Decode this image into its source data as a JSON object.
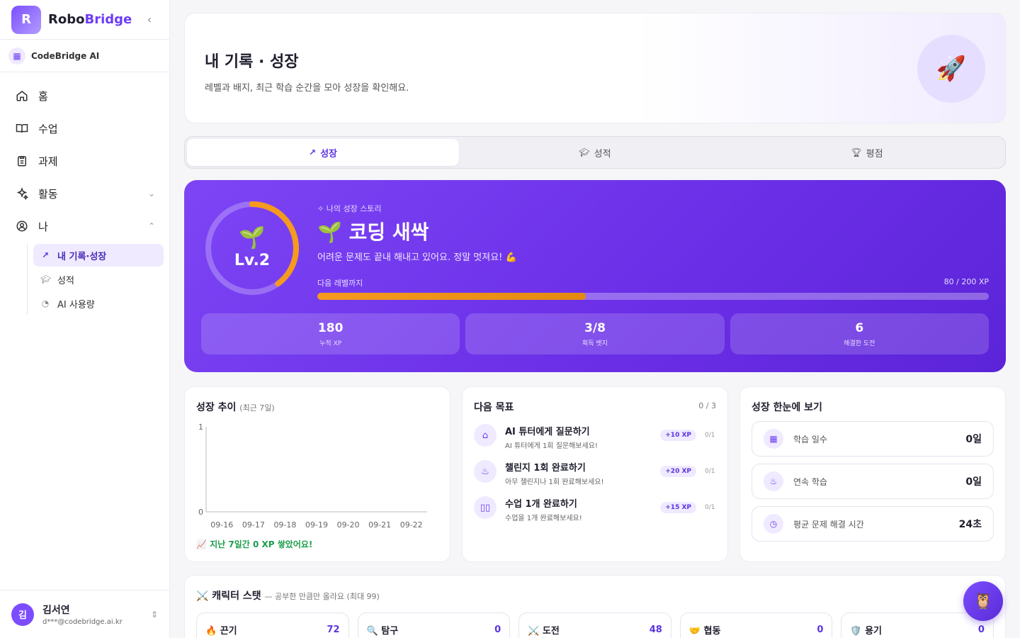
{
  "brand": {
    "logo_text": "R",
    "name_a": "Robo",
    "name_b": "Bridge"
  },
  "org": {
    "name": "CodeBridge AI"
  },
  "nav": {
    "items": [
      {
        "label": "홈"
      },
      {
        "label": "수업"
      },
      {
        "label": "과제"
      },
      {
        "label": "활동"
      },
      {
        "label": "나"
      }
    ],
    "sub": [
      {
        "label": "내 기록·성장"
      },
      {
        "label": "성적"
      },
      {
        "label": "AI 사용량"
      }
    ]
  },
  "user": {
    "initial": "김",
    "name": "김서연",
    "email": "d***@codebridge.ai.kr"
  },
  "header": {
    "title": "내 기록 · 성장",
    "subtitle": "레벨과 배지, 최근 학습 순간을 모아 성장을 확인해요."
  },
  "tabs": [
    {
      "label": "성장"
    },
    {
      "label": "성적"
    },
    {
      "label": "평점"
    }
  ],
  "hero": {
    "level": "Lv.2",
    "story_label": "나의 성장 스토리",
    "title": "🌱 코딩 새싹",
    "desc": "어려운 문제도 끝내 해내고 있어요. 정말 멋져요! 💪",
    "progress_label": "다음 레벨까지",
    "progress_text": "80 / 200 XP",
    "progress": 0.4,
    "stats": [
      {
        "value": "180",
        "label": "누적 XP"
      },
      {
        "value": "3/8",
        "label": "획득 뱃지"
      },
      {
        "value": "6",
        "label": "해결한 도전"
      }
    ]
  },
  "trend": {
    "title": "성장 추이",
    "title_small": "(최근 7일)",
    "footer": "📈 지난 7일간 0 XP 쌓았어요!"
  },
  "chart_data": {
    "type": "line",
    "categories": [
      "09-16",
      "09-17",
      "09-18",
      "09-19",
      "09-20",
      "09-21",
      "09-22"
    ],
    "values": [
      0,
      0,
      0,
      0,
      0,
      0,
      0
    ],
    "ylim": [
      0,
      1
    ],
    "yticks": [
      "1",
      "0"
    ],
    "title": "성장 추이",
    "grid": false
  },
  "goals": {
    "title": "다음 목표",
    "count": "0 / 3",
    "items": [
      {
        "name": "AI 튜터에게 질문하기",
        "desc": "AI 튜터에게 1회 질문해보세요!",
        "xp": "+10 XP",
        "prog": "0/1",
        "icon": "robot-icon"
      },
      {
        "name": "챌린지 1회 완료하기",
        "desc": "아무 챌린지나 1회 완료해보세요!",
        "xp": "+20 XP",
        "prog": "0/1",
        "icon": "flame-icon"
      },
      {
        "name": "수업 1개 완료하기",
        "desc": "수업을 1개 완료해보세요!",
        "xp": "+15 XP",
        "prog": "0/1",
        "icon": "book-icon"
      }
    ]
  },
  "glance": {
    "title": "성장 한눈에 보기",
    "items": [
      {
        "label": "학습 일수",
        "value": "0일"
      },
      {
        "label": "연속 학습",
        "value": "0일"
      },
      {
        "label": "평균 문제 해결 시간",
        "value": "24초"
      }
    ]
  },
  "char_stats": {
    "title": "⚔️ 캐릭터 스탯",
    "title_small": "— 공부한 만큼만 올라요 (최대 99)",
    "items": [
      {
        "label": "🔥 끈기",
        "value": "72"
      },
      {
        "label": "🔍 탐구",
        "value": "0"
      },
      {
        "label": "⚔️ 도전",
        "value": "48"
      },
      {
        "label": "🤝 협동",
        "value": "0"
      },
      {
        "label": "🛡️ 용기",
        "value": "0"
      }
    ]
  },
  "colors": {
    "accent": "#6d3df5",
    "hero": "#6a2ee6",
    "progress": "#f59a1e",
    "success": "#1b9e4b"
  }
}
